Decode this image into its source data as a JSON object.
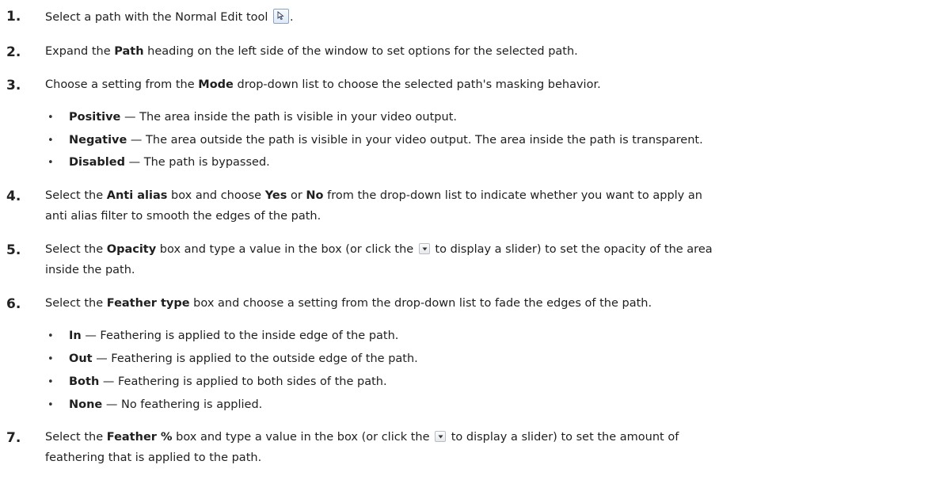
{
  "steps": [
    {
      "num": "1.",
      "pre": "Select a path with the Normal Edit tool ",
      "icon": "normal-edit-tool-icon",
      "post": "."
    },
    {
      "num": "2.",
      "pre": "Expand the ",
      "bold": "Path",
      "post": " heading on the left side of the window to set options for the selected path."
    },
    {
      "num": "3.",
      "pre": "Choose a setting from the ",
      "bold": "Mode",
      "post": " drop-down list to choose the selected path's masking behavior.",
      "bullets": [
        {
          "bold": "Positive",
          "text": " — The area inside the path is visible in your video output."
        },
        {
          "bold": "Negative",
          "text": " — The area outside the path is visible in your video output. The area inside the path is transparent."
        },
        {
          "bold": "Disabled",
          "text": " — The path is bypassed."
        }
      ]
    },
    {
      "num": "4.",
      "pre": "Select the ",
      "bold": "Anti alias",
      "mid1": " box and choose ",
      "bold2": "Yes",
      "mid2": " or ",
      "bold3": "No",
      "post_line1": " from the drop-down list to indicate whether you want to apply an",
      "line2": "anti alias filter to smooth the edges of the path."
    },
    {
      "num": "5.",
      "pre": "Select the ",
      "bold": "Opacity",
      "mid1": " box and type a value in the box (or click the ",
      "icon": "dropdown-arrow-icon",
      "post_line1": " to display a slider) to set the opacity of the area",
      "line2": "inside the path."
    },
    {
      "num": "6.",
      "pre": "Select the ",
      "bold": "Feather type",
      "post": " box and choose a setting from the drop-down list to fade the edges of the path.",
      "bullets": [
        {
          "bold": "In",
          "text": " — Feathering is applied to the inside edge of the path."
        },
        {
          "bold": "Out",
          "text": " — Feathering is applied to the outside edge of the path."
        },
        {
          "bold": "Both",
          "text": " — Feathering is applied to both sides of the path."
        },
        {
          "bold": "None",
          "text": " — No feathering is applied."
        }
      ]
    },
    {
      "num": "7.",
      "pre": "Select the ",
      "bold": "Feather %",
      "mid1": " box and type a value in the box (or click the ",
      "icon": "dropdown-arrow-icon",
      "post_line1": " to display a slider) to set the amount of",
      "line2": "feathering that is applied to the path."
    }
  ],
  "bullet_glyph": "•",
  "colors": {
    "text": "#1f1f1f",
    "icon_border": "#8aa3c4"
  }
}
